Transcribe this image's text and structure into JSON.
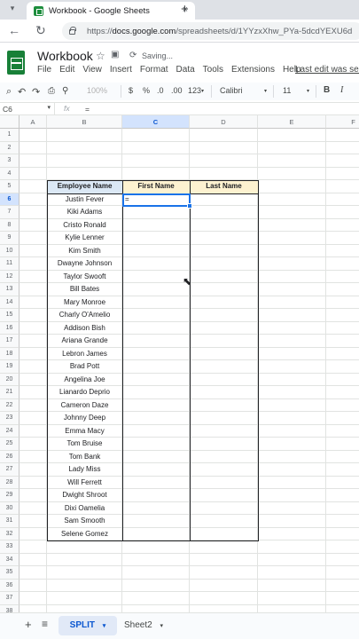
{
  "browser": {
    "tab_title": "Workbook - Google Sheets",
    "tab_close": "×",
    "new_tab": "+",
    "url_host": "docs.google.com",
    "url_path": "/spreadsheets/d/1YYzxXhw_PYa-5dcdYEXU6d"
  },
  "header": {
    "title": "Workbook",
    "status": "Saving...",
    "last_edit": "Last edit was seco"
  },
  "menu": [
    "File",
    "Edit",
    "View",
    "Insert",
    "Format",
    "Data",
    "Tools",
    "Extensions",
    "Help"
  ],
  "toolbar": {
    "zoom": "100%",
    "currency": "$",
    "percent": "%",
    "dec_decrease": ".0",
    "dec_increase": ".00",
    "number_format": "123",
    "font": "Calibri",
    "font_size": "11",
    "bold": "B",
    "italic": "I"
  },
  "formula_bar": {
    "cell_ref": "C6",
    "fx": "fx",
    "content": "="
  },
  "columns": [
    "A",
    "B",
    "C",
    "D",
    "E",
    "F"
  ],
  "selected_column": "C",
  "rows": [
    "1",
    "2",
    "3",
    "4",
    "5",
    "6",
    "7",
    "8",
    "9",
    "10",
    "11",
    "12",
    "13",
    "14",
    "15",
    "16",
    "17",
    "18",
    "19",
    "20",
    "21",
    "22",
    "23",
    "24",
    "25",
    "26",
    "27",
    "28",
    "29",
    "30",
    "31",
    "32",
    "33",
    "34",
    "35",
    "36",
    "37",
    "38"
  ],
  "selected_row": "6",
  "table": {
    "headers": [
      "Employee Name",
      "First Name",
      "Last Name"
    ],
    "header_colors": [
      "#dbe8f5",
      "#fdf2d0",
      "#fdf2d0"
    ],
    "names": [
      "Justin Fever",
      "Kiki Adams",
      "Cristo Ronald",
      "Kylie Lenner",
      "Kim Smith",
      "Dwayne Johnson",
      "Taylor Swooft",
      "Bill Bates",
      "Mary Monroe",
      "Charly O'Amelio",
      "Addison Bish",
      "Ariana Grande",
      "Lebron James",
      "Brad Pott",
      "Angelina Joe",
      "Lianardo Deprio",
      "Cameron Daze",
      "Johnny Deep",
      "Emma Macy",
      "Tom Bruise",
      "Tom Bank",
      "Lady Miss",
      "Will Ferrett",
      "Dwight Shroot",
      "Dixi Oamelia",
      "Sam Smooth",
      "Selene Gomez"
    ],
    "active_input": "="
  },
  "sheets": {
    "add": "+",
    "all": "≡",
    "tabs": [
      {
        "name": "SPLIT",
        "active": true
      },
      {
        "name": "Sheet2",
        "active": false
      }
    ],
    "caret": "▾"
  }
}
